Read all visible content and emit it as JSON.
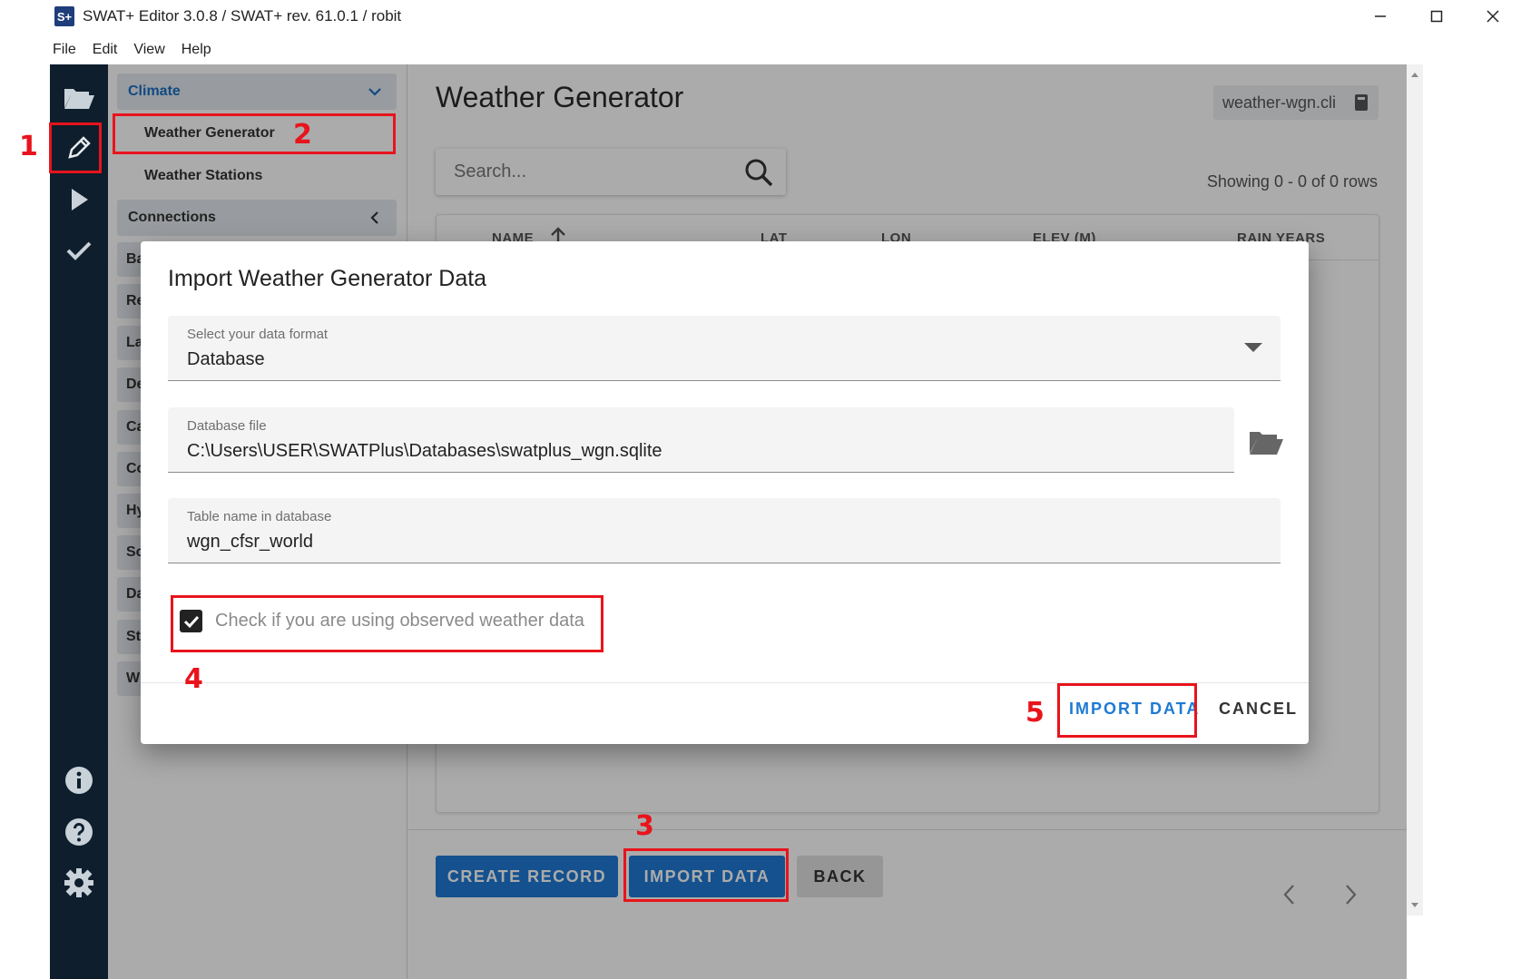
{
  "window": {
    "logo": "S+",
    "title": "SWAT+ Editor 3.0.8 / SWAT+ rev. 61.0.1 / robit",
    "controls": [
      "minimize-icon",
      "maximize-icon",
      "close-icon"
    ]
  },
  "menubar": {
    "items": [
      "File",
      "Edit",
      "View",
      "Help"
    ]
  },
  "rail": {
    "icons": [
      "folder-open-icon",
      "pencil-icon",
      "play-icon",
      "check-icon",
      "info-icon",
      "help-icon",
      "gear-icon"
    ],
    "active": "pencil-icon"
  },
  "sidebar": {
    "climate": "Climate",
    "weather_generator": "Weather Generator",
    "weather_stations": "Weather Stations",
    "connections": "Connections",
    "stubs": [
      "Ba",
      "Re",
      "La",
      "De",
      "Ca",
      "Co",
      "Hy",
      "So",
      "Da",
      "St",
      "W"
    ]
  },
  "main": {
    "title": "Weather Generator",
    "file_chip": "weather-wgn.cli",
    "search_placeholder": "Search...",
    "row_count": "Showing 0 - 0 of 0 rows",
    "columns": [
      "NAME",
      "LAT",
      "LON",
      "ELEV (M)",
      "RAIN YEARS"
    ],
    "buttons": {
      "create": "CREATE RECORD",
      "import": "IMPORT DATA",
      "back": "BACK"
    }
  },
  "dialog": {
    "title": "Import Weather Generator Data",
    "format_label": "Select your data format",
    "format_value": "Database",
    "db_file_label": "Database file",
    "db_file_value": "C:\\Users\\USER\\SWATPlus\\Databases\\swatplus_wgn.sqlite",
    "table_label": "Table name in database",
    "table_value": "wgn_cfsr_world",
    "checkbox_label": "Check if you are using observed weather data",
    "checkbox_checked": true,
    "import_button": "IMPORT DATA",
    "cancel_button": "CANCEL"
  },
  "annotations": [
    "1",
    "2",
    "3",
    "4",
    "5"
  ],
  "colors": {
    "rail": "#0e1e2d",
    "accent": "#1f7ad4",
    "annotation": "#e8141c"
  }
}
